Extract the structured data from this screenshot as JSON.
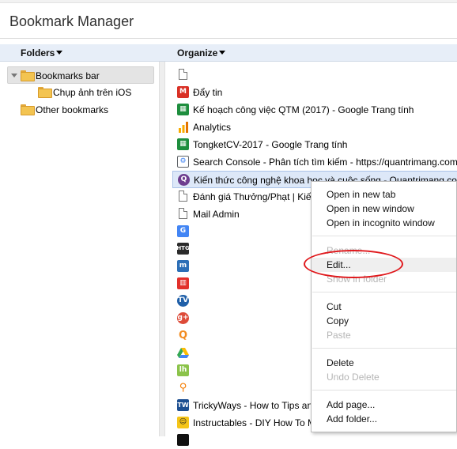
{
  "app": {
    "title": "Bookmark Manager"
  },
  "columns": {
    "folders": "Folders",
    "organize": "Organize"
  },
  "tree": [
    {
      "label": "Bookmarks bar",
      "expanded": true,
      "selected": true
    },
    {
      "label": "Chụp ảnh trên iOS"
    },
    {
      "label": "Other bookmarks"
    }
  ],
  "bookmarks": [
    {
      "icon": "blank-page-icon",
      "title": ""
    },
    {
      "icon": "gmail-icon",
      "title": "Đẩy tin"
    },
    {
      "icon": "google-sheets-icon",
      "title": "Kế hoạch công việc QTM (2017) - Google Trang tính"
    },
    {
      "icon": "analytics-icon",
      "title": "Analytics"
    },
    {
      "icon": "google-sheets-icon",
      "title": "TongketCV-2017 - Google Trang tính"
    },
    {
      "icon": "search-console-icon",
      "title": "Search Console - Phân tích tìm kiếm - https://quantrimang.com"
    },
    {
      "icon": "quantrimang-icon",
      "title": "Kiến thức công nghệ khoa học và cuộc sống - Quantrimang.com"
    },
    {
      "icon": "blank-page-icon",
      "title": "Đánh giá Thưởng/Phạt | Kiến"
    },
    {
      "icon": "blank-page-icon",
      "title": "Mail Admin"
    },
    {
      "icon": "google-translate-icon",
      "title": ""
    },
    {
      "icon": "htg-icon",
      "title": ""
    },
    {
      "icon": "makeuseof-icon",
      "title": ""
    },
    {
      "icon": "red-book-icon",
      "title": ""
    },
    {
      "icon": "tv-icon",
      "title": ""
    },
    {
      "icon": "gplus-icon",
      "title": ""
    },
    {
      "icon": "search-orange-icon",
      "title": ""
    },
    {
      "icon": "google-drive-icon",
      "title": ""
    },
    {
      "icon": "lifehacker-icon",
      "title": ""
    },
    {
      "icon": "location-pin-icon",
      "title": ""
    },
    {
      "icon": "trickyways-icon",
      "title": "TrickyWays - How to Tips an"
    },
    {
      "icon": "instructables-icon",
      "title": "Instructables - DIY How To M"
    }
  ],
  "context_menu": {
    "groups": [
      [
        {
          "label": "Open in new tab"
        },
        {
          "label": "Open in new window"
        },
        {
          "label": "Open in incognito window"
        }
      ],
      [
        {
          "label": "Rename...",
          "disabled": true
        },
        {
          "label": "Edit...",
          "highlighted": true
        },
        {
          "label": "Show in folder",
          "disabled": true
        }
      ],
      [
        {
          "label": "Cut"
        },
        {
          "label": "Copy"
        },
        {
          "label": "Paste",
          "disabled": true
        }
      ],
      [
        {
          "label": "Delete"
        },
        {
          "label": "Undo Delete",
          "disabled": true
        }
      ],
      [
        {
          "label": "Add page..."
        },
        {
          "label": "Add folder..."
        }
      ]
    ]
  },
  "annotation": {
    "color": "#e0181c"
  }
}
